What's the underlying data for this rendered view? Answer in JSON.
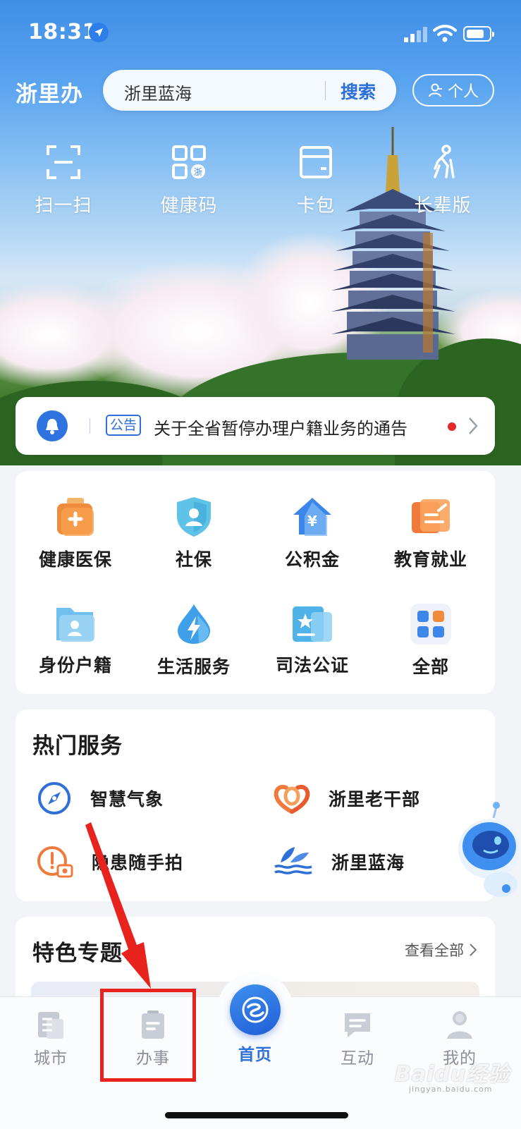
{
  "status_bar": {
    "time": "18:31"
  },
  "header": {
    "app_name": "浙里办",
    "search_placeholder": "浙里蓝海",
    "search_button": "搜索",
    "personal_label": "个人"
  },
  "quick_actions": [
    {
      "label": "扫一扫",
      "icon": "scan-icon"
    },
    {
      "label": "健康码",
      "icon": "health-code-icon"
    },
    {
      "label": "卡包",
      "icon": "card-wallet-icon"
    },
    {
      "label": "长辈版",
      "icon": "elder-mode-icon"
    }
  ],
  "notice": {
    "tag": "公告",
    "text": "关于全省暂停办理户籍业务的通告"
  },
  "services": [
    {
      "label": "健康医保",
      "icon": "medical-kit-icon"
    },
    {
      "label": "社保",
      "icon": "shield-person-icon"
    },
    {
      "label": "公积金",
      "icon": "house-yuan-icon"
    },
    {
      "label": "教育就业",
      "icon": "education-icon"
    },
    {
      "label": "身份户籍",
      "icon": "id-folder-icon"
    },
    {
      "label": "生活服务",
      "icon": "lightning-drop-icon"
    },
    {
      "label": "司法公证",
      "icon": "justice-card-icon"
    },
    {
      "label": "全部",
      "icon": "all-grid-icon"
    }
  ],
  "hot_services": {
    "title": "热门服务",
    "items": [
      {
        "label": "智慧气象",
        "icon": "compass-icon"
      },
      {
        "label": "浙里老干部",
        "icon": "heart-ring-icon"
      },
      {
        "label": "隐患随手拍",
        "icon": "alert-camera-icon"
      },
      {
        "label": "浙里蓝海",
        "icon": "wave-leaf-icon"
      }
    ]
  },
  "featured": {
    "title": "特色专题",
    "see_all": "查看全部"
  },
  "tabs": [
    {
      "label": "城市",
      "active": false
    },
    {
      "label": "办事",
      "active": false
    },
    {
      "label": "首页",
      "active": true
    },
    {
      "label": "互动",
      "active": false
    },
    {
      "label": "我的",
      "active": false
    }
  ],
  "watermark": {
    "brand": "Baidu经验",
    "url": "jingyan.baidu.com"
  },
  "colors": {
    "accent_blue": "#2f6fd8",
    "annotation_red": "#e8231e",
    "notice_dot": "#e62828"
  }
}
